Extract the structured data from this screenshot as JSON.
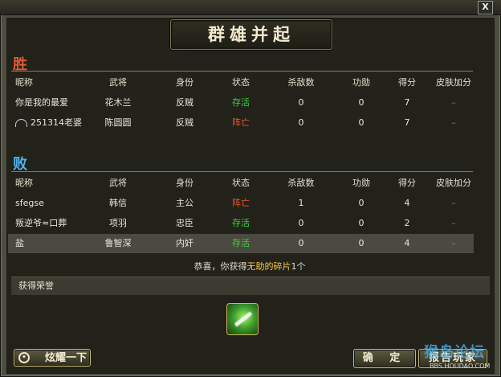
{
  "window": {
    "close_glyph": "X"
  },
  "title": "群雄并起",
  "columns": [
    "昵称",
    "武将",
    "身份",
    "状态",
    "杀敌数",
    "功勋",
    "得分",
    "皮肤加分"
  ],
  "win": {
    "label": "胜",
    "rows": [
      {
        "name": "你是我的最爱",
        "general": "花木兰",
        "role": "反贼",
        "status": "存活",
        "status_type": "alive",
        "kills": "0",
        "merit": "0",
        "score": "7",
        "skin_bonus": "–",
        "icon": ""
      },
      {
        "name": "251314老婆",
        "general": "陈圆圆",
        "role": "反贼",
        "status": "阵亡",
        "status_type": "dead",
        "kills": "0",
        "merit": "0",
        "score": "7",
        "skin_bonus": "–",
        "icon": "wifi-icon"
      }
    ]
  },
  "lose": {
    "label": "败",
    "rows": [
      {
        "name": "sfegse",
        "general": "韩信",
        "role": "主公",
        "status": "阵亡",
        "status_type": "dead",
        "kills": "1",
        "merit": "0",
        "score": "4",
        "skin_bonus": "–",
        "icon": ""
      },
      {
        "name": "叛逆爷≈口葬",
        "general": "项羽",
        "role": "忠臣",
        "status": "存活",
        "status_type": "alive",
        "kills": "0",
        "merit": "0",
        "score": "2",
        "skin_bonus": "–",
        "icon": ""
      },
      {
        "name": "盐",
        "general": "鲁智深",
        "role": "内奸",
        "status": "存活",
        "status_type": "alive",
        "kills": "0",
        "merit": "0",
        "score": "4",
        "skin_bonus": "–",
        "icon": "",
        "highlight": true
      }
    ]
  },
  "message": {
    "prefix": "恭喜，你获得",
    "item": "无助的碎片",
    "suffix": "1个"
  },
  "honor": {
    "label": "获得荣誉",
    "reward_icon": "dagger-reward-icon"
  },
  "buttons": {
    "show_off": "炫耀一下",
    "confirm": "确 定",
    "report": "报告玩家"
  },
  "watermark": {
    "text": "猴岛论坛",
    "url": "BBS.HOUDAO.COM"
  },
  "colors": {
    "win": "#e05b2c",
    "lose": "#4db3ef",
    "alive": "#3ed43a",
    "dead": "#e45a2c",
    "highlight": "#f1cc45"
  }
}
